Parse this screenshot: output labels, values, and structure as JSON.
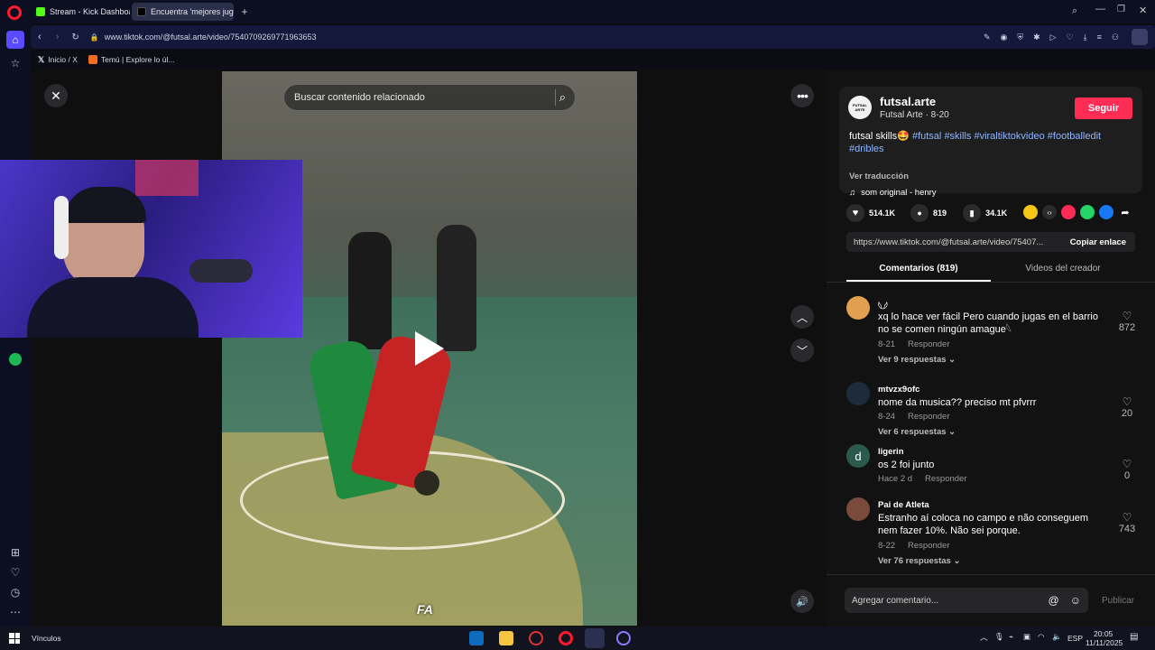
{
  "browser": {
    "tabs": [
      {
        "label": "Stream - Kick Dashboard",
        "color": "#53fc18"
      },
      {
        "label": "Encuentra 'mejores jugad",
        "color": "#111111"
      }
    ],
    "new_tab_symbol": "+",
    "url": "www.tiktok.com/@futsal.arte/video/7540709269771963653",
    "bookmarks": [
      {
        "label": "Inicio / X"
      },
      {
        "label": "Temú | Explore lo úl..."
      }
    ]
  },
  "video": {
    "search_placeholder": "Buscar contenido relacionado",
    "watermark": "FA"
  },
  "author": {
    "avatar_text": "FUTSAL ARTE",
    "name": "futsal.arte",
    "subtitle": "Futsal Arte · 8-20",
    "follow_label": "Seguir"
  },
  "description": {
    "text": "futsal skills🤩",
    "hashtags": [
      "#futsal",
      "#skills",
      "#viraltiktokvideo",
      "#footballedit",
      "#dribles"
    ],
    "translate_label": "Ver traducción",
    "sound": "som original - henry"
  },
  "stats": {
    "likes": "514.1K",
    "comments": "819",
    "saves": "34.1K"
  },
  "share": {
    "link": "https://www.tiktok.com/@futsal.arte/video/75407...",
    "copy_label": "Copiar enlace"
  },
  "tabs": {
    "comments": "Comentarios (819)",
    "creator_videos": "Videos del creador"
  },
  "comments": [
    {
      "user": "𓆩𓆪",
      "text": "xq lo hace ver fácil Pero cuando jugas en el barrio no se comen ningún amague𓆩",
      "date": "8-21",
      "reply": "Responder",
      "likes": "872",
      "more": "Ver 9 respuestas",
      "avatar_color": "#e0a050",
      "initial": ""
    },
    {
      "user": "mtvzx9ofc",
      "text": "nome da musica?? preciso mt pfvrrr",
      "date": "8-24",
      "reply": "Responder",
      "likes": "20",
      "more": "Ver 6 respuestas",
      "avatar_color": "#1d2b3a",
      "initial": ""
    },
    {
      "user": "ligerin",
      "text": "os 2 foi junto",
      "date": "Hace 2 d",
      "reply": "Responder",
      "likes": "0",
      "more": "",
      "avatar_color": "#2b5a4d",
      "initial": "d"
    },
    {
      "user": "Pai de Atleta",
      "text": "Estranho aí coloca no campo e não conseguem nem fazer 10%. Não sei porque.",
      "date": "8-22",
      "reply": "Responder",
      "likes": "743",
      "more": "Ver 76 respuestas",
      "avatar_color": "#7a4a3a",
      "initial": ""
    }
  ],
  "comment_box": {
    "placeholder": "Agregar comentario...",
    "post_label": "Publicar"
  },
  "taskbar": {
    "label": "Vínculos",
    "lang": "ESP",
    "time": "20:05",
    "date": "11/11/2025"
  },
  "colors": {
    "accent_red": "#fe2c55",
    "hashtag_blue": "#8fb5ff"
  }
}
